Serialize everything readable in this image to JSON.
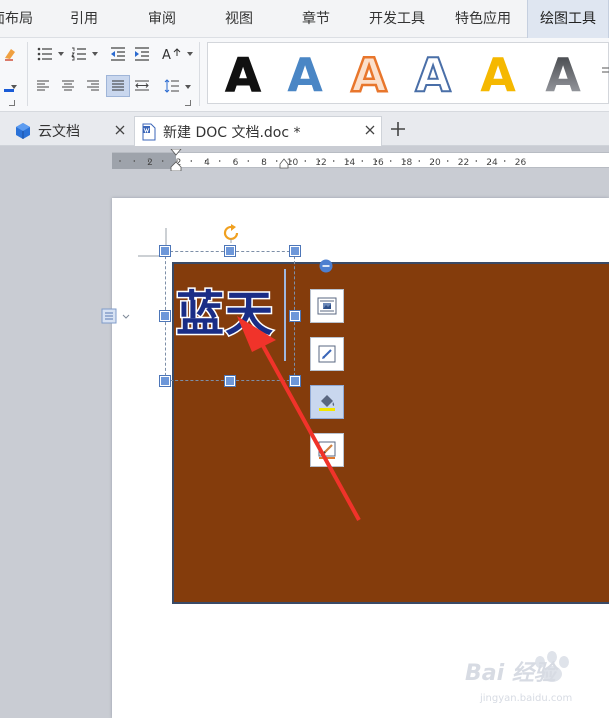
{
  "menu": {
    "tabs": [
      {
        "label": "页面布局"
      },
      {
        "label": "引用"
      },
      {
        "label": "审阅"
      },
      {
        "label": "视图"
      },
      {
        "label": "章节"
      },
      {
        "label": "开发工具"
      },
      {
        "label": "特色应用"
      },
      {
        "label": "绘图工具"
      }
    ],
    "active_tab": "绘图工具"
  },
  "ribbon": {
    "text_effect_label": "A",
    "styles": [
      {
        "letter": "A",
        "fill": "#111111",
        "stroke": "#111111"
      },
      {
        "letter": "A",
        "fill": "#4a86c5",
        "stroke": "#4a86c5"
      },
      {
        "letter": "A",
        "fill": "#ffffff",
        "stroke": "#e8762c"
      },
      {
        "letter": "A",
        "fill": "#ffffff",
        "stroke": "#4a6fa8"
      },
      {
        "letter": "A",
        "fill": "#f5b800",
        "stroke": "#f5b800"
      },
      {
        "letter": "A",
        "fill": "#6b6e73",
        "stroke": "#6b6e73"
      }
    ]
  },
  "doc_tabs": [
    {
      "label": "云文档"
    },
    {
      "label": "新建 DOC 文档.doc *"
    }
  ],
  "ruler": {
    "labels": [
      "2",
      "2",
      "4",
      "6",
      "8",
      "10",
      "12",
      "14",
      "16",
      "18",
      "20",
      "22",
      "24",
      "26"
    ]
  },
  "document": {
    "selected_text": "蓝天",
    "shape_fill": "#843c0c",
    "text_fill": "#1a2d86"
  },
  "floating_toolbar": [
    {
      "name": "layout-options-icon"
    },
    {
      "name": "shape-edit-icon"
    },
    {
      "name": "fill-bucket-icon",
      "pressed": true
    },
    {
      "name": "outline-pen-icon"
    }
  ],
  "watermark": {
    "brand": "Bai 经验",
    "url": "jingyan.baidu.com"
  }
}
